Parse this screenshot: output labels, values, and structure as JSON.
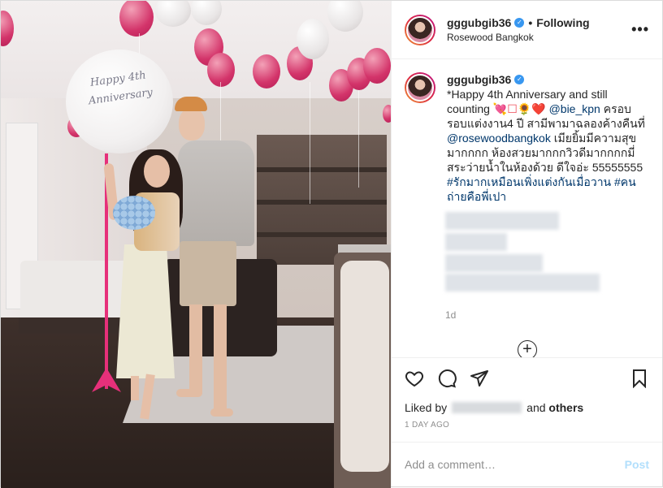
{
  "photo": {
    "balloon_text": "Happy 4th\nAnniversary"
  },
  "header": {
    "username": "gggubgib36",
    "separator": "•",
    "follow_state": "Following",
    "location": "Rosewood Bangkok",
    "more": "•••"
  },
  "caption": {
    "username": "gggubgib36",
    "part1": "*Happy 4th Anniversary and still counting ",
    "emojis": "💘☐🌻❤️",
    "mention1": "@bie_kpn",
    "part2": " ครอบรอบแต่งงาน4 ปี สามีพามาฉลองค้างคืนที่ ",
    "mention2": "@rosewoodbangkok",
    "part3": " เมียยิ้มมีความสุขมากกกก ห้องสวยมากกกวิวดีมากกกกมี่สระว่ายน้ำในห้องด้วย ดีใจอ่ะ 55555555 ",
    "hashtags": "#รักมากเหมือนเพิ่งแต่งกันเมื่อวาน #คนถ่ายคือพี่เปา"
  },
  "comments": {
    "time": "1d",
    "load_more": "+"
  },
  "likes": {
    "prefix": "Liked by",
    "suffix_and": "and",
    "suffix_others": "others"
  },
  "date": "1 DAY AGO",
  "comment_box": {
    "placeholder": "Add a comment…",
    "post_label": "Post"
  }
}
